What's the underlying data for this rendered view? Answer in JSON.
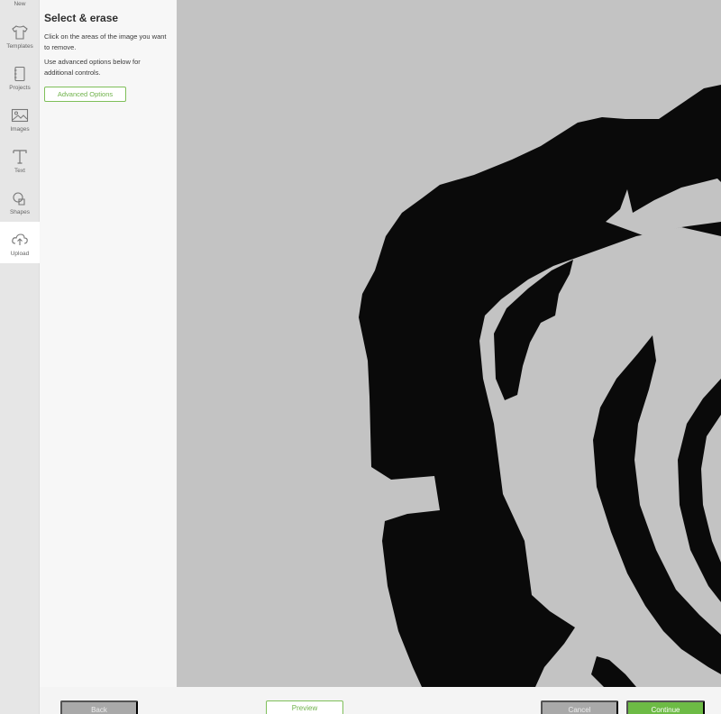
{
  "rail": {
    "new_label": "New",
    "items": [
      {
        "label": "Templates",
        "icon": "tshirt-icon"
      },
      {
        "label": "Projects",
        "icon": "notebook-icon"
      },
      {
        "label": "Images",
        "icon": "image-icon"
      },
      {
        "label": "Text",
        "icon": "text-icon"
      },
      {
        "label": "Shapes",
        "icon": "shapes-icon"
      },
      {
        "label": "Upload",
        "icon": "cloud-upload-icon"
      }
    ]
  },
  "panel": {
    "title": "Select & erase",
    "text1": "Click on the areas of the image you want to remove.",
    "text2": "Use advanced options below for additional controls.",
    "advanced_label": "Advanced Options"
  },
  "footer": {
    "back_label": "Back",
    "preview_label": "Preview",
    "cancel_label": "Cancel",
    "continue_label": "Continue"
  },
  "colors": {
    "accent": "#6dbb45",
    "canvas_bg": "#c3c3c3",
    "image_fg": "#0a0a0a"
  }
}
